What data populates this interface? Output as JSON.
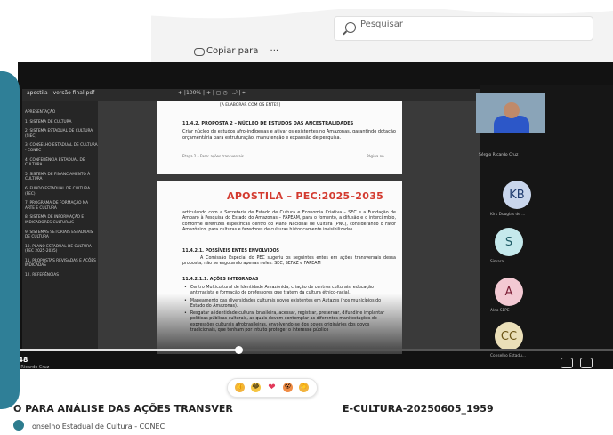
{
  "browser": {
    "search_placeholder": "Pesquisar",
    "copy_label": "Copiar para",
    "more_label": "···"
  },
  "pdf": {
    "filename": "apostila - versão final.pdf",
    "toolbar": "+ |100% | + | ▢ ◴ | ⤾ | ⌖",
    "toc": [
      "APRESENTAÇÃO",
      "1. SISTEMA DE CULTURA",
      "2. SISTEMA ESTADUAL DE CULTURA (SIEC)",
      "3. CONSELHO ESTADUAL DE CULTURA - CONEC",
      "4. CONFERÊNCIA ESTADUAL DE CULTURA",
      "5. SISTEMA DE FINANCIAMENTO À CULTURA",
      "6. FUNDO ESTADUAL DE CULTURA (FEC)",
      "7. PROGRAMA DE FORMAÇÃO NA ARTE E CULTURA",
      "8. SISTEMA DE INFORMAÇÃO E INDICADORES CULTURAIS",
      "9. SISTEMAS SETORIAIS ESTADUAIS DE CULTURA",
      "10. PLANO ESTADUAL DE CULTURA (PEC 2025-2035)",
      "11. PROPOSTAS REVISADAS E AÇÕES INDICADAS",
      "12. REFERÊNCIAS"
    ],
    "page1": {
      "top_line": "[A ELABORAR COM OS ENTES]",
      "heading": "11.4.2. PROPOSTA 2 – NÚCLEO DE ESTUDOS DAS ANCESTRALIDADES",
      "body": "Criar núcleo de estudos afro-indígenas e ativar os existentes no Amazonas, garantindo dotação orçamentária para estruturação, manutenção e expansão de pesquisa.",
      "footer_left": "Etapa 2 – Fase: ações transversais",
      "footer_right": "Página nn"
    },
    "page2": {
      "title": "APOSTILA – PEC:2025–2035",
      "intro": "articulando com a Secretaria de Estado de Cultura e Economia Criativa – SEC e a Fundação de Amparo à Pesquisa do Estado do Amazonas – FAPEAM, para o fomento, a difusão e o intercâmbio, conforme diretrizes específicas dentro do Plano Nacional de Cultura (PNC), considerando o Fator Amazônico, para culturas e fazedores de culturas historicamente invisibilizadas.",
      "sec1_heading": "11.4.2.1. POSSÍVEIS ENTES ENVOLVIDOS",
      "sec1_body": "A Comissão Especial do PEC sugeriu os seguintes entes em ações transversais dessa proposta, não se esgotando apenas neles: SEC, SEFAZ e FAPEAM",
      "sec2_heading": "11.4.2.1.1. AÇÕES INTEGRADAS",
      "bullets": [
        "Centro Multicultural de Identidade Amazônida, criação de centros culturais, educação antirracista e formação de professores que tratem da cultura étnico-racial.",
        "Mapeamento das diversidades culturais povos existentes em Autazes (nos municípios do Estado do Amazonas).",
        "Resgatar a identidade cultural brasileira, acessar, registrar, preservar, difundir e implantar políticas públicas culturais, as quais devem contemplar as diferentes manifestações de expressões culturais afrobrasileiras, envolvendo-se dos povos originários dos povos tradicionais, que tenham por intuito proteger o interesse público"
      ]
    }
  },
  "player": {
    "time": "09:48",
    "presenter": "Sérgio Ricardo Cruz",
    "progress": 0.37
  },
  "participants": {
    "camera_name": "Sérgio Ricardo Cruz",
    "list": [
      {
        "initials": "KB",
        "name": "Kirk Douglas de ...",
        "color": "#c9d6ec",
        "fg": "#1e3a6e"
      },
      {
        "initials": "S",
        "name": "Simara",
        "color": "#c5e9ec",
        "fg": "#1f5c66"
      },
      {
        "initials": "A",
        "name": "Aldo SEPE",
        "color": "#f3c9d3",
        "fg": "#7a1d35"
      },
      {
        "initials": "CC",
        "name": "Conselho Estadu...",
        "color": "#eadfb8",
        "fg": "#6b5414"
      }
    ]
  },
  "reactions": [
    "👍",
    "😂",
    "❤",
    "😮",
    "👏"
  ],
  "meeting": {
    "title_left": "O PARA ANÁLISE DAS AÇÕES TRANSVER",
    "title_right": "E-CULTURA-20250605_1959",
    "organizer": "onselho Estadual de Cultura - CONEC"
  }
}
